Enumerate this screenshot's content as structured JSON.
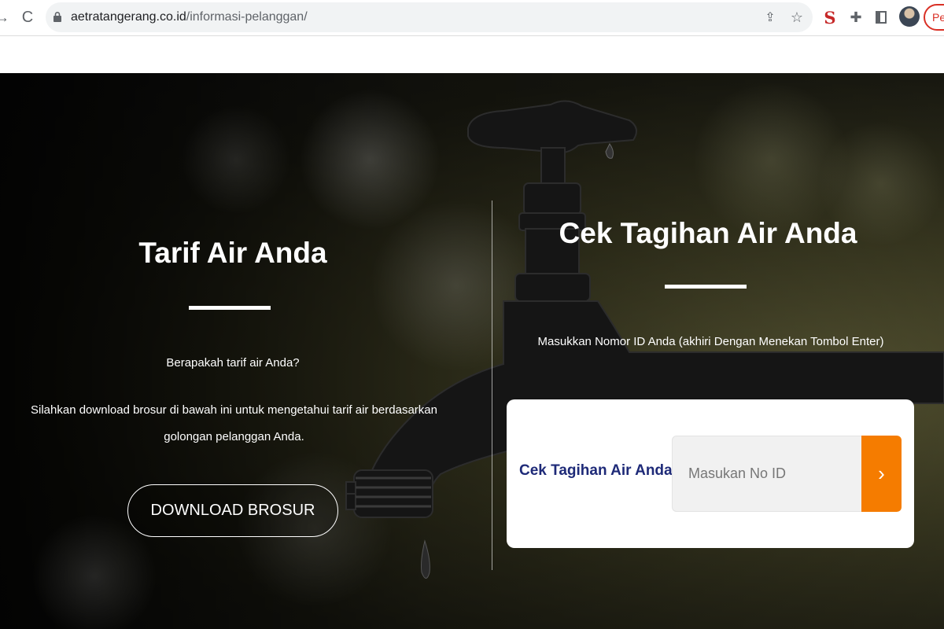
{
  "browser": {
    "url_domain": "aetratangerang.co.id",
    "url_path": "/informasi-pelanggan/",
    "profile_label": "Pe",
    "icons": {
      "back": "back-arrow-icon",
      "reload": "reload-icon",
      "lock": "lock-icon",
      "share": "share-icon",
      "star": "star-icon",
      "extension_s": "s-extension-icon",
      "puzzle": "puzzle-icon",
      "side_panel": "side-panel-icon"
    },
    "glyphs": {
      "back": "→",
      "reload": "C",
      "share": "⇪",
      "star": "☆",
      "extension_s": "S",
      "puzzle": "✚"
    }
  },
  "hero": {
    "tarif": {
      "title": "Tarif Air Anda",
      "question": "Berapakah tarif air Anda?",
      "description": "Silahkan download brosur di bawah ini untuk mengetahui tarif air berdasarkan golongan pelanggan Anda.",
      "button_label": "DOWNLOAD BROSUR"
    },
    "cek": {
      "title": "Cek Tagihan Air Anda",
      "instruction": "Masukkan Nomor ID Anda (akhiri Dengan Menekan Tombol Enter)",
      "card_label": "Cek Tagihan Air Anda",
      "input_placeholder": "Masukan No ID",
      "input_value": "",
      "submit_glyph": "›"
    }
  },
  "colors": {
    "accent_orange": "#f57c00",
    "card_label_navy": "#1e2a78"
  }
}
